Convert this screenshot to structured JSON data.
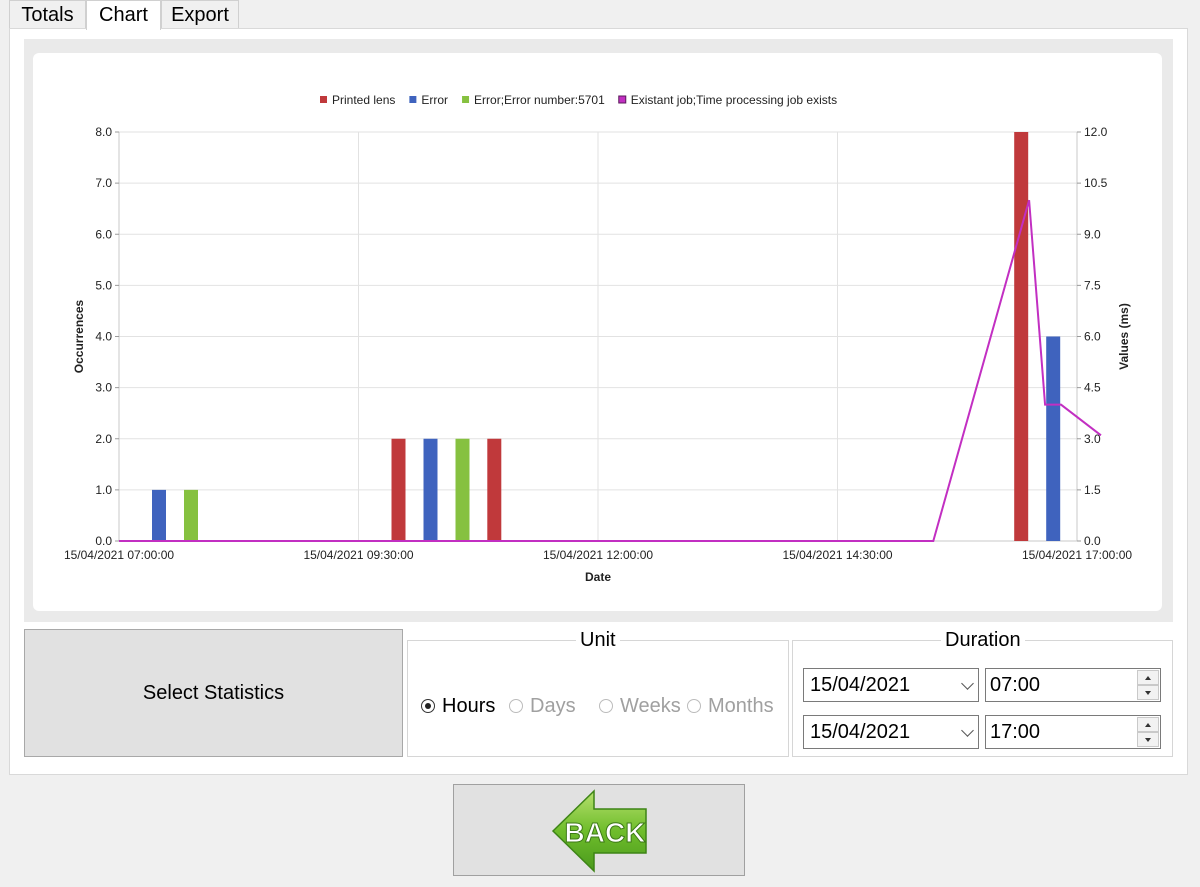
{
  "tabs": [
    {
      "label": "Totals"
    },
    {
      "label": "Chart"
    },
    {
      "label": "Export"
    }
  ],
  "active_tab": "Chart",
  "chart_data": {
    "type": "bar",
    "title": "",
    "xlabel": "Date",
    "ylabel": "Occurrences",
    "y2label": "Values (ms)",
    "ylim": [
      0,
      8
    ],
    "y2lim": [
      0,
      12
    ],
    "yticks": [
      "0.0",
      "1.0",
      "2.0",
      "3.0",
      "4.0",
      "5.0",
      "6.0",
      "7.0",
      "8.0"
    ],
    "y2ticks": [
      "0.0",
      "1.5",
      "3.0",
      "4.5",
      "6.0",
      "7.5",
      "9.0",
      "10.5",
      "12.0"
    ],
    "xticks": [
      "15/04/2021 07:00:00",
      "15/04/2021 09:30:00",
      "15/04/2021 12:00:00",
      "15/04/2021 14:30:00",
      "15/04/2021 17:00:00"
    ],
    "xlim": [
      "15/04/2021 07:00:00",
      "15/04/2021 17:00:00"
    ],
    "legend_position": "top-center",
    "grid": true,
    "series": [
      {
        "name": "Printed lens",
        "type": "bar",
        "axis": "left",
        "color": "#c0393b",
        "points": [
          {
            "x": "15/04/2021 09:30",
            "y": 2
          },
          {
            "x": "15/04/2021 10:30",
            "y": 2
          },
          {
            "x": "15/04/2021 16:00",
            "y": 8
          }
        ]
      },
      {
        "name": "Error",
        "type": "bar",
        "axis": "left",
        "color": "#3f63be",
        "points": [
          {
            "x": "15/04/2021 07:00",
            "y": 1
          },
          {
            "x": "15/04/2021 09:30",
            "y": 2
          },
          {
            "x": "15/04/2021 16:00",
            "y": 4
          }
        ]
      },
      {
        "name": "Error;Error number:5701",
        "type": "bar",
        "axis": "left",
        "color": "#86c140",
        "points": [
          {
            "x": "15/04/2021 07:00",
            "y": 1
          },
          {
            "x": "15/04/2021 09:30",
            "y": 2
          }
        ]
      },
      {
        "name": "Existant job;Time processing job exists",
        "type": "line",
        "axis": "right",
        "color": "#c22fc2",
        "points": [
          {
            "x": "15/04/2021 07:00",
            "y": 0
          },
          {
            "x": "15/04/2021 15:30",
            "y": 0
          },
          {
            "x": "15/04/2021 16:30",
            "y": 10
          },
          {
            "x": "15/04/2021 16:40",
            "y": 4
          },
          {
            "x": "15/04/2021 16:50",
            "y": 4
          },
          {
            "x": "15/04/2021 17:15",
            "y": 3.1
          }
        ]
      }
    ]
  },
  "controls": {
    "select_statistics_label": "Select Statistics",
    "unit": {
      "title": "Unit",
      "options": [
        {
          "label": "Hours",
          "selected": true,
          "enabled": true
        },
        {
          "label": "Days",
          "selected": false,
          "enabled": false
        },
        {
          "label": "Weeks",
          "selected": false,
          "enabled": false
        },
        {
          "label": "Months",
          "selected": false,
          "enabled": false
        }
      ]
    },
    "duration": {
      "title": "Duration",
      "start_date": "15/04/2021",
      "start_time": "07:00",
      "end_date": "15/04/2021",
      "end_time": "17:00"
    },
    "back_label": "BACK"
  },
  "colors": {
    "back_arrow": "#5aa623",
    "back_arrow_light": "#9bd256"
  }
}
